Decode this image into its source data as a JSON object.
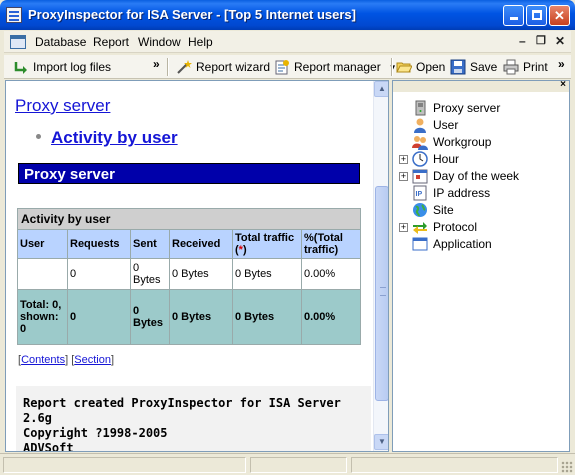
{
  "window": {
    "title": "ProxyInspector for ISA Server - [Top 5 Internet users]"
  },
  "menu": {
    "items": [
      "Database",
      "Report",
      "Window",
      "Help"
    ]
  },
  "toolbar": {
    "import_log": "Import log files",
    "report_wizard": "Report wizard",
    "report_manager": "Report manager",
    "open": "Open",
    "save": "Save",
    "print": "Print"
  },
  "report": {
    "heading_link": "Proxy server",
    "sub_link": "Activity by user",
    "section_title": "Proxy server",
    "table": {
      "caption": "Activity by user",
      "headers": [
        "User",
        "Requests",
        "Sent",
        "Received",
        "Total traffic (",
        "*",
        ")",
        "%(Total traffic)"
      ],
      "row": [
        "",
        "0",
        "0 Bytes",
        "0 Bytes",
        "0 Bytes",
        "0.00%"
      ],
      "total_row": [
        "Total: 0, shown: 0",
        "0",
        "0 Bytes",
        "0 Bytes",
        "0 Bytes",
        "0.00%"
      ]
    },
    "nav": {
      "contents": "Contents",
      "section": "Section"
    },
    "footer": [
      "Report created ProxyInspector for ISA Server",
      "2.6g",
      "Copyright ?1998-2005",
      "ADVSoft"
    ]
  },
  "tree": {
    "items": [
      {
        "label": "Proxy server",
        "icon": "server-icon",
        "expandable": false
      },
      {
        "label": "User",
        "icon": "user-icon",
        "expandable": false
      },
      {
        "label": "Workgroup",
        "icon": "workgroup-icon",
        "expandable": false
      },
      {
        "label": "Hour",
        "icon": "clock-icon",
        "expandable": true
      },
      {
        "label": "Day of the week",
        "icon": "calendar-icon",
        "expandable": true
      },
      {
        "label": "IP address",
        "icon": "ip-icon",
        "expandable": false
      },
      {
        "label": "Site",
        "icon": "globe-icon",
        "expandable": false
      },
      {
        "label": "Protocol",
        "icon": "protocol-icon",
        "expandable": true
      },
      {
        "label": "Application",
        "icon": "window-icon",
        "expandable": false
      }
    ]
  },
  "colors": {
    "titlebar": "#0054e3",
    "section_bg": "#0000aa",
    "header_bg": "#b9d3ff",
    "total_bg": "#9ccaca",
    "link": "#1515d6"
  }
}
